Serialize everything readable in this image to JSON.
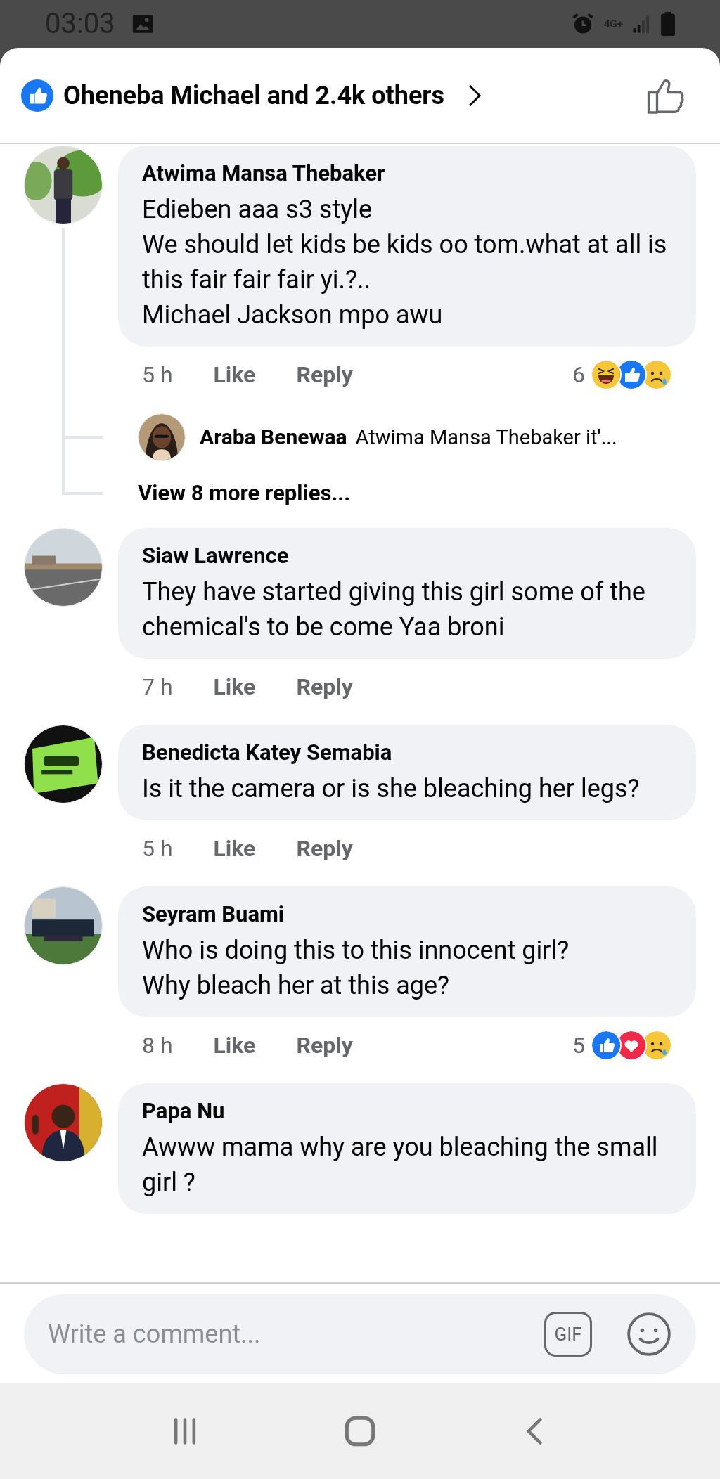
{
  "status_bar": {
    "time": "03:03",
    "network": "4G+"
  },
  "likes_header": {
    "text": "Oheneba Michael and 2.4k others"
  },
  "comments": [
    {
      "author": "Atwima Mansa Thebaker",
      "text": "Edieben aaa s3 style\nWe should let kids be kids oo tom.what at all is this fair fair fair yi.?..\nMichael Jackson mpo awu",
      "time": "5 h",
      "like": "Like",
      "reply": "Reply",
      "reaction_count": "6",
      "reactions": [
        {
          "kind": "haha"
        },
        {
          "kind": "like"
        },
        {
          "kind": "sad"
        }
      ],
      "replies": [
        {
          "author": "Araba Benewaa",
          "text": "Atwima Mansa Thebaker it'..."
        }
      ],
      "more_replies": "View 8 more replies..."
    },
    {
      "author": "Siaw Lawrence",
      "text": "They have started giving this girl some of the chemical's to be come Yaa broni",
      "time": "7 h",
      "like": "Like",
      "reply": "Reply"
    },
    {
      "author": "Benedicta Katey Semabia",
      "text": "Is it the camera or is she bleaching her legs?",
      "time": "5 h",
      "like": "Like",
      "reply": "Reply"
    },
    {
      "author": "Seyram Buami",
      "text": "Who is doing this to this innocent girl?\nWhy bleach her at this age?",
      "time": "8 h",
      "like": "Like",
      "reply": "Reply",
      "reaction_count": "5",
      "reactions": [
        {
          "kind": "like"
        },
        {
          "kind": "love"
        },
        {
          "kind": "sad"
        }
      ]
    },
    {
      "author": "Papa Nu",
      "text": "Awww mama why are you bleaching the small girl ?"
    }
  ],
  "composer": {
    "placeholder": "Write a comment...",
    "gif": "GIF"
  }
}
